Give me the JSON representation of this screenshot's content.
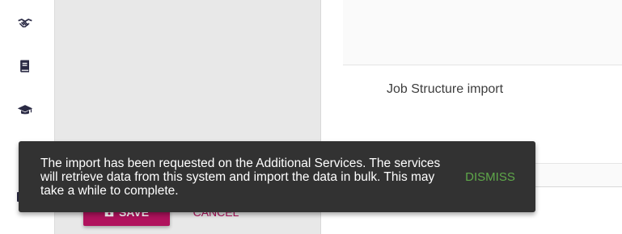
{
  "sidebar": {
    "items": [
      {
        "icon": "handshake-icon"
      },
      {
        "icon": "book-icon"
      },
      {
        "icon": "graduation-cap-icon"
      }
    ]
  },
  "main": {
    "job_structure_label": "Job Structure import",
    "save_label": "SAVE",
    "cancel_label": "CANCEL"
  },
  "snackbar": {
    "message": "The import has been requested on the Additional Services. The services will retrieve data from this system and import the data in bulk. This may take a while to complete.",
    "dismiss_label": "DISMISS",
    "dismiss_color": "#5fa84a"
  },
  "colors": {
    "accent": "#b0125d",
    "snackbar_bg": "#323232",
    "sidebar_icon": "#2a2a44"
  }
}
